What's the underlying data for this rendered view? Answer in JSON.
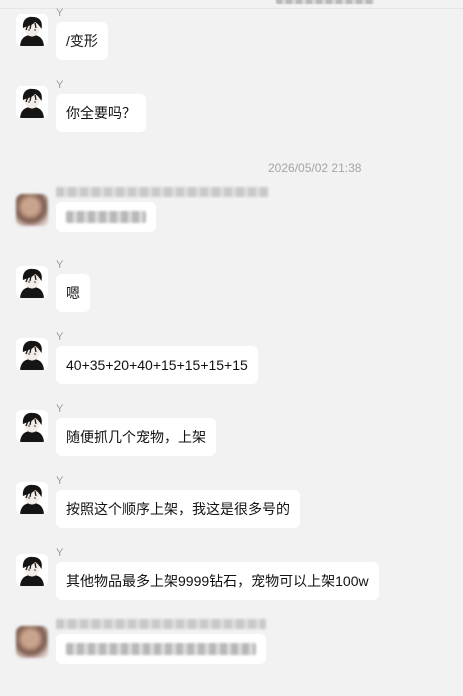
{
  "messages": [
    {
      "sender": "Y",
      "text": "/变形"
    },
    {
      "sender": "Y",
      "text": "你全要吗？"
    },
    {
      "sender": "Y",
      "text": "嗯"
    },
    {
      "sender": "Y",
      "text": "40+35+20+40+15+15+15+15"
    },
    {
      "sender": "Y",
      "text": "随便抓几个宠物，上架"
    },
    {
      "sender": "Y",
      "text": "按照这个顺序上架，我这是很多号的"
    },
    {
      "sender": "Y",
      "text": "其他物品最多上架9999钻石，宠物可以上架100w"
    }
  ],
  "timestamp": "2026/05/02 21:38",
  "colors": {
    "background": "#f2f2f2",
    "bubble": "#ffffff",
    "sender": "#9a9a9a",
    "timestamp": "#a5a5a5"
  },
  "icons": {
    "avatar": "anime-boy-avatar-icon"
  }
}
